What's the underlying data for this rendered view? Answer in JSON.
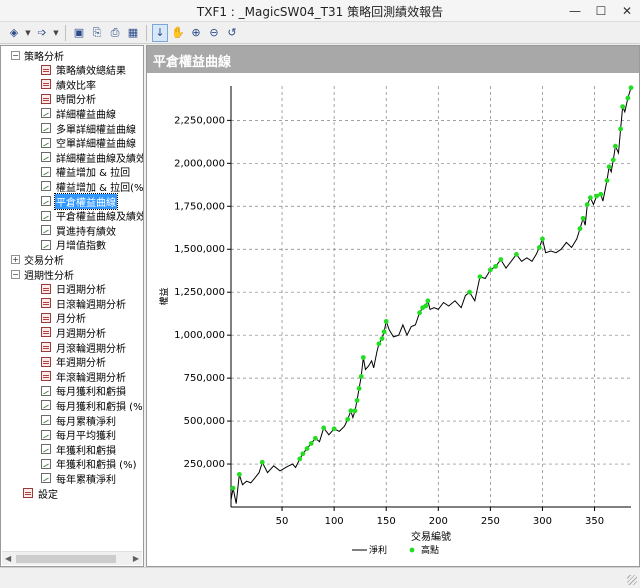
{
  "window": {
    "title": "TXF1 : _MagicSW04_T31 策略回測績效報告"
  },
  "toolbar": {
    "buttons": [
      {
        "name": "back-button",
        "glyph": "◈",
        "dropdown": true
      },
      {
        "name": "forward-button",
        "glyph": "➩",
        "dropdown": true
      },
      {
        "name": "save-button",
        "glyph": "▣"
      },
      {
        "name": "copy-button",
        "glyph": "⎘"
      },
      {
        "name": "print-button",
        "glyph": "⎙"
      },
      {
        "name": "table-button",
        "glyph": "▦"
      },
      {
        "name": "pointer-tool-button",
        "glyph": "↓",
        "selected": true
      },
      {
        "name": "pan-tool-button",
        "glyph": "✋"
      },
      {
        "name": "zoom-in-button",
        "glyph": "⊕"
      },
      {
        "name": "zoom-out-button",
        "glyph": "⊖"
      },
      {
        "name": "reset-button",
        "glyph": "↺"
      }
    ]
  },
  "tree": [
    {
      "label": "策略分析",
      "level": 0,
      "exp": "−"
    },
    {
      "label": "策略績效總結果",
      "level": 1,
      "icon": "grid"
    },
    {
      "label": "績效比率",
      "level": 1,
      "icon": "grid"
    },
    {
      "label": "時間分析",
      "level": 1,
      "icon": "grid"
    },
    {
      "label": "詳細權益曲線",
      "level": 1,
      "icon": "chart"
    },
    {
      "label": "多單詳細權益曲線",
      "level": 1,
      "icon": "chart"
    },
    {
      "label": "空單詳細權益曲線",
      "level": 1,
      "icon": "chart"
    },
    {
      "label": "詳細權益曲線及績效",
      "level": 1,
      "icon": "chart"
    },
    {
      "label": "權益增加 & 拉回",
      "level": 1,
      "icon": "chart"
    },
    {
      "label": "權益增加 & 拉回(%)",
      "level": 1,
      "icon": "chart"
    },
    {
      "label": "平倉權益曲線",
      "level": 1,
      "icon": "chart",
      "selected": true
    },
    {
      "label": "平倉權益曲線及績效",
      "level": 1,
      "icon": "chart"
    },
    {
      "label": "買進持有績效",
      "level": 1,
      "icon": "chart"
    },
    {
      "label": "月增值指數",
      "level": 1,
      "icon": "chart"
    },
    {
      "label": "交易分析",
      "level": 0,
      "exp": "+"
    },
    {
      "label": "週期性分析",
      "level": 0,
      "exp": "−"
    },
    {
      "label": "日週期分析",
      "level": 1,
      "icon": "grid"
    },
    {
      "label": "日滾輪週期分析",
      "level": 1,
      "icon": "grid"
    },
    {
      "label": "月分析",
      "level": 1,
      "icon": "grid"
    },
    {
      "label": "月週期分析",
      "level": 1,
      "icon": "grid"
    },
    {
      "label": "月滾輪週期分析",
      "level": 1,
      "icon": "grid"
    },
    {
      "label": "年週期分析",
      "level": 1,
      "icon": "grid"
    },
    {
      "label": "年滾輪週期分析",
      "level": 1,
      "icon": "grid"
    },
    {
      "label": "每月獲利和虧損",
      "level": 1,
      "icon": "chart"
    },
    {
      "label": "每月獲利和虧損 (%)",
      "level": 1,
      "icon": "chart"
    },
    {
      "label": "每月累積淨利",
      "level": 1,
      "icon": "chart"
    },
    {
      "label": "每月平均獲利",
      "level": 1,
      "icon": "chart"
    },
    {
      "label": "年獲利和虧損",
      "level": 1,
      "icon": "chart"
    },
    {
      "label": "年獲利和虧損 (%)",
      "level": 1,
      "icon": "chart"
    },
    {
      "label": "每年累積淨利",
      "level": 1,
      "icon": "chart"
    },
    {
      "label": "設定",
      "level": 0,
      "icon": "grid"
    }
  ],
  "panel": {
    "title": "平倉權益曲線"
  },
  "colors": {
    "line": "#000000",
    "highs": "#22dd22",
    "grid": "#808080",
    "header": "#a8a8a8"
  },
  "chart_data": {
    "type": "line",
    "title": "平倉權益曲線",
    "xlabel": "交易編號",
    "ylabel": "權益",
    "xlim": [
      1,
      385
    ],
    "ylim": [
      0,
      2450000
    ],
    "xticks": [
      50,
      100,
      150,
      200,
      250,
      300,
      350
    ],
    "yticks": [
      250000,
      500000,
      750000,
      1000000,
      1250000,
      1500000,
      1750000,
      2000000,
      2250000
    ],
    "ytick_labels": [
      "250,000",
      "500,000",
      "750,000",
      "1,000,000",
      "1,250,000",
      "1,500,000",
      "1,750,000",
      "2,000,000",
      "2,250,000"
    ],
    "grid": true,
    "legend": {
      "position": "bottom",
      "entries": [
        {
          "label": "淨利",
          "style": "line"
        },
        {
          "label": "高點",
          "style": "marker"
        }
      ]
    },
    "series": [
      {
        "name": "淨利",
        "style": "line",
        "points": [
          [
            1,
            40000
          ],
          [
            3,
            110000
          ],
          [
            6,
            20000
          ],
          [
            9,
            190000
          ],
          [
            12,
            130000
          ],
          [
            16,
            150000
          ],
          [
            20,
            140000
          ],
          [
            24,
            170000
          ],
          [
            28,
            200000
          ],
          [
            31,
            260000
          ],
          [
            36,
            200000
          ],
          [
            42,
            240000
          ],
          [
            48,
            210000
          ],
          [
            55,
            235000
          ],
          [
            60,
            250000
          ],
          [
            63,
            230000
          ],
          [
            67,
            280000
          ],
          [
            70,
            310000
          ],
          [
            74,
            340000
          ],
          [
            78,
            370000
          ],
          [
            82,
            400000
          ],
          [
            86,
            380000
          ],
          [
            90,
            460000
          ],
          [
            95,
            420000
          ],
          [
            100,
            455000
          ],
          [
            105,
            440000
          ],
          [
            110,
            470000
          ],
          [
            113,
            510000
          ],
          [
            116,
            560000
          ],
          [
            118,
            520000
          ],
          [
            120,
            560000
          ],
          [
            122,
            620000
          ],
          [
            124,
            690000
          ],
          [
            126,
            760000
          ],
          [
            128,
            870000
          ],
          [
            130,
            800000
          ],
          [
            133,
            820000
          ],
          [
            136,
            850000
          ],
          [
            138,
            810000
          ],
          [
            141,
            900000
          ],
          [
            143,
            950000
          ],
          [
            146,
            980000
          ],
          [
            148,
            1020000
          ],
          [
            150,
            1080000
          ],
          [
            153,
            1030000
          ],
          [
            157,
            990000
          ],
          [
            162,
            1000000
          ],
          [
            166,
            1060000
          ],
          [
            170,
            1000000
          ],
          [
            174,
            1050000
          ],
          [
            178,
            1060000
          ],
          [
            182,
            1130000
          ],
          [
            185,
            1160000
          ],
          [
            188,
            1170000
          ],
          [
            190,
            1200000
          ],
          [
            192,
            1150000
          ],
          [
            196,
            1160000
          ],
          [
            200,
            1150000
          ],
          [
            205,
            1190000
          ],
          [
            210,
            1170000
          ],
          [
            216,
            1200000
          ],
          [
            222,
            1160000
          ],
          [
            226,
            1230000
          ],
          [
            230,
            1250000
          ],
          [
            235,
            1200000
          ],
          [
            240,
            1340000
          ],
          [
            245,
            1330000
          ],
          [
            250,
            1380000
          ],
          [
            255,
            1400000
          ],
          [
            260,
            1440000
          ],
          [
            265,
            1390000
          ],
          [
            270,
            1430000
          ],
          [
            275,
            1470000
          ],
          [
            280,
            1430000
          ],
          [
            285,
            1450000
          ],
          [
            290,
            1430000
          ],
          [
            294,
            1470000
          ],
          [
            297,
            1510000
          ],
          [
            300,
            1560000
          ],
          [
            303,
            1480000
          ],
          [
            308,
            1490000
          ],
          [
            313,
            1480000
          ],
          [
            318,
            1500000
          ],
          [
            323,
            1540000
          ],
          [
            328,
            1510000
          ],
          [
            333,
            1560000
          ],
          [
            336,
            1620000
          ],
          [
            339,
            1680000
          ],
          [
            341,
            1640000
          ],
          [
            343,
            1760000
          ],
          [
            346,
            1800000
          ],
          [
            349,
            1760000
          ],
          [
            352,
            1810000
          ],
          [
            356,
            1820000
          ],
          [
            358,
            1780000
          ],
          [
            362,
            1900000
          ],
          [
            364,
            1980000
          ],
          [
            366,
            1950000
          ],
          [
            368,
            2020000
          ],
          [
            370,
            2100000
          ],
          [
            373,
            2060000
          ],
          [
            375,
            2200000
          ],
          [
            377,
            2330000
          ],
          [
            379,
            2300000
          ],
          [
            382,
            2380000
          ],
          [
            385,
            2440000
          ]
        ]
      },
      {
        "name": "高點",
        "style": "marker",
        "points": [
          [
            3,
            110000
          ],
          [
            9,
            190000
          ],
          [
            31,
            260000
          ],
          [
            67,
            280000
          ],
          [
            70,
            310000
          ],
          [
            74,
            340000
          ],
          [
            78,
            370000
          ],
          [
            82,
            400000
          ],
          [
            90,
            460000
          ],
          [
            100,
            455000
          ],
          [
            113,
            510000
          ],
          [
            116,
            560000
          ],
          [
            120,
            560000
          ],
          [
            122,
            620000
          ],
          [
            124,
            690000
          ],
          [
            126,
            760000
          ],
          [
            128,
            870000
          ],
          [
            143,
            950000
          ],
          [
            146,
            980000
          ],
          [
            148,
            1020000
          ],
          [
            150,
            1080000
          ],
          [
            182,
            1130000
          ],
          [
            185,
            1160000
          ],
          [
            188,
            1170000
          ],
          [
            190,
            1200000
          ],
          [
            230,
            1250000
          ],
          [
            240,
            1340000
          ],
          [
            250,
            1380000
          ],
          [
            255,
            1400000
          ],
          [
            260,
            1440000
          ],
          [
            275,
            1470000
          ],
          [
            297,
            1510000
          ],
          [
            300,
            1560000
          ],
          [
            336,
            1620000
          ],
          [
            339,
            1680000
          ],
          [
            343,
            1760000
          ],
          [
            346,
            1800000
          ],
          [
            352,
            1810000
          ],
          [
            356,
            1820000
          ],
          [
            362,
            1900000
          ],
          [
            364,
            1980000
          ],
          [
            368,
            2020000
          ],
          [
            370,
            2100000
          ],
          [
            375,
            2200000
          ],
          [
            377,
            2330000
          ],
          [
            382,
            2380000
          ],
          [
            385,
            2440000
          ]
        ]
      }
    ]
  }
}
